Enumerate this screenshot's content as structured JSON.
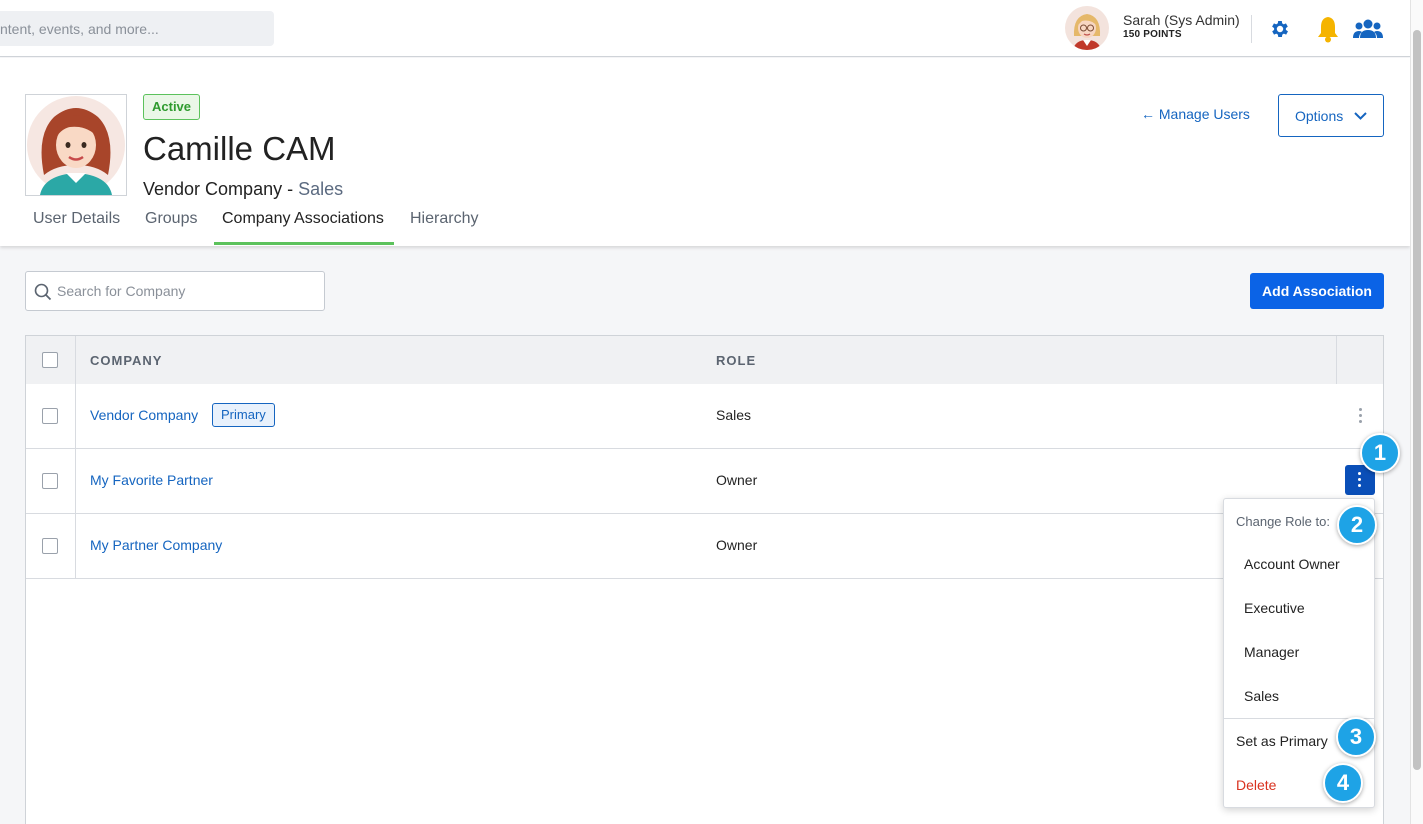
{
  "topbar": {
    "search_placeholder": "ntent, events, and more...",
    "user_name": "Sarah (Sys Admin)",
    "user_points": "150 POINTS",
    "icons": [
      "gear-icon",
      "bell-icon",
      "users-icon"
    ]
  },
  "profile": {
    "status": "Active",
    "name": "Camille CAM",
    "company": "Vendor Company",
    "separator": " - ",
    "department": "Sales",
    "manage_users_link": "Manage Users",
    "options_label": "Options"
  },
  "tabs": [
    "User Details",
    "Groups",
    "Company Associations",
    "Hierarchy"
  ],
  "active_tab": "Company Associations",
  "associations": {
    "search_placeholder": "Search for Company",
    "add_button": "Add Association",
    "columns": {
      "company": "COMPANY",
      "role": "ROLE"
    },
    "rows": [
      {
        "company": "Vendor Company",
        "badge": "Primary",
        "role": "Sales"
      },
      {
        "company": "My Favorite Partner",
        "badge": "",
        "role": "Owner"
      },
      {
        "company": "My Partner Company",
        "badge": "",
        "role": "Owner"
      }
    ]
  },
  "menu": {
    "header": "Change Role to:",
    "roles": [
      "Account Owner",
      "Executive",
      "Manager",
      "Sales"
    ],
    "set_primary": "Set as Primary",
    "delete": "Delete"
  },
  "callouts": [
    "1",
    "2",
    "3",
    "4"
  ],
  "colors": {
    "brand_blue": "#0b63e6",
    "active_green": "#5cc25c",
    "danger": "#d9321f",
    "callout": "#1ea3e6"
  }
}
